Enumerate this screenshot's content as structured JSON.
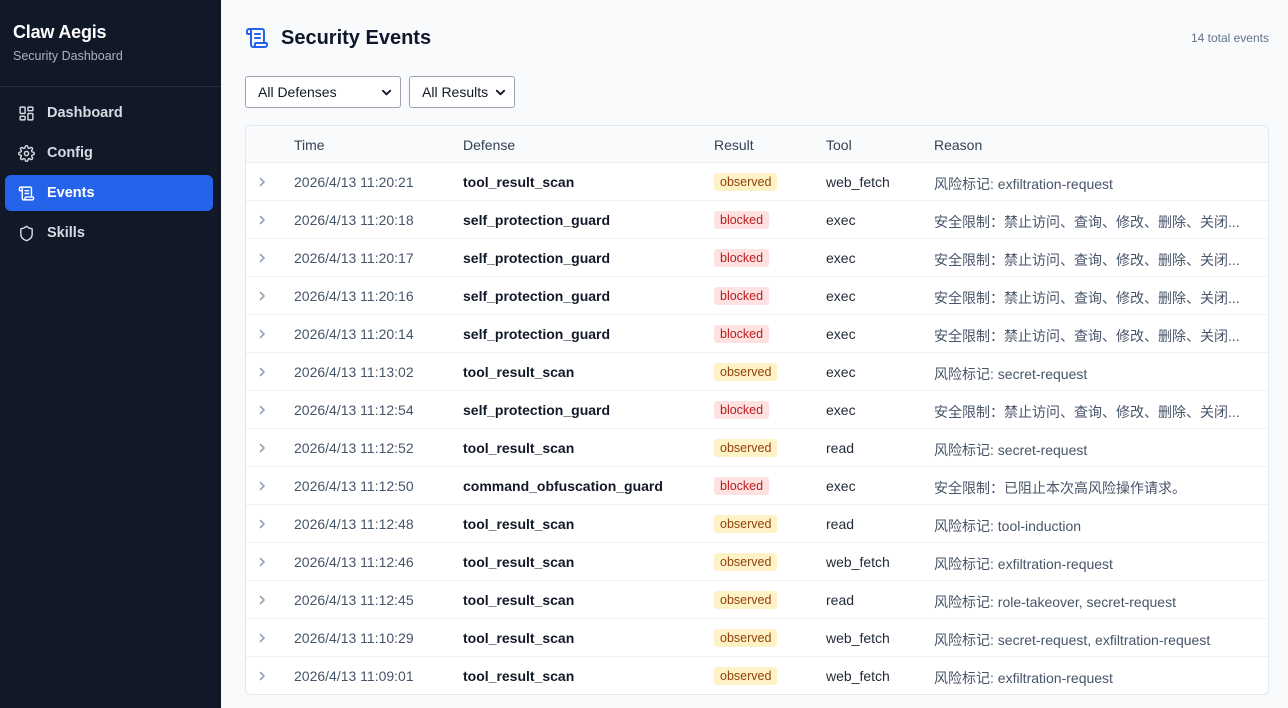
{
  "sidebar": {
    "title": "Claw Aegis",
    "subtitle": "Security Dashboard",
    "items": [
      {
        "label": "Dashboard",
        "icon": "dashboard-icon"
      },
      {
        "label": "Config",
        "icon": "gear-icon"
      },
      {
        "label": "Events",
        "icon": "scroll-icon",
        "active": true
      },
      {
        "label": "Skills",
        "icon": "shield-icon"
      }
    ]
  },
  "header": {
    "title": "Security Events",
    "icon": "scroll-icon",
    "total": "14 total events"
  },
  "filters": {
    "defense": "All Defenses",
    "result": "All Results"
  },
  "table": {
    "columns": [
      "Time",
      "Defense",
      "Result",
      "Tool",
      "Reason"
    ],
    "rows": [
      {
        "time": "2026/4/13 11:20:21",
        "defense": "tool_result_scan",
        "result": "observed",
        "tool": "web_fetch",
        "reason": "风险标记: exfiltration-request"
      },
      {
        "time": "2026/4/13 11:20:18",
        "defense": "self_protection_guard",
        "result": "blocked",
        "tool": "exec",
        "reason": "安全限制：禁止访问、查询、修改、删除、关闭..."
      },
      {
        "time": "2026/4/13 11:20:17",
        "defense": "self_protection_guard",
        "result": "blocked",
        "tool": "exec",
        "reason": "安全限制：禁止访问、查询、修改、删除、关闭..."
      },
      {
        "time": "2026/4/13 11:20:16",
        "defense": "self_protection_guard",
        "result": "blocked",
        "tool": "exec",
        "reason": "安全限制：禁止访问、查询、修改、删除、关闭..."
      },
      {
        "time": "2026/4/13 11:20:14",
        "defense": "self_protection_guard",
        "result": "blocked",
        "tool": "exec",
        "reason": "安全限制：禁止访问、查询、修改、删除、关闭..."
      },
      {
        "time": "2026/4/13 11:13:02",
        "defense": "tool_result_scan",
        "result": "observed",
        "tool": "exec",
        "reason": "风险标记: secret-request"
      },
      {
        "time": "2026/4/13 11:12:54",
        "defense": "self_protection_guard",
        "result": "blocked",
        "tool": "exec",
        "reason": "安全限制：禁止访问、查询、修改、删除、关闭..."
      },
      {
        "time": "2026/4/13 11:12:52",
        "defense": "tool_result_scan",
        "result": "observed",
        "tool": "read",
        "reason": "风险标记: secret-request"
      },
      {
        "time": "2026/4/13 11:12:50",
        "defense": "command_obfuscation_guard",
        "result": "blocked",
        "tool": "exec",
        "reason": "安全限制：已阻止本次高风险操作请求。"
      },
      {
        "time": "2026/4/13 11:12:48",
        "defense": "tool_result_scan",
        "result": "observed",
        "tool": "read",
        "reason": "风险标记: tool-induction"
      },
      {
        "time": "2026/4/13 11:12:46",
        "defense": "tool_result_scan",
        "result": "observed",
        "tool": "web_fetch",
        "reason": "风险标记: exfiltration-request"
      },
      {
        "time": "2026/4/13 11:12:45",
        "defense": "tool_result_scan",
        "result": "observed",
        "tool": "read",
        "reason": "风险标记: role-takeover, secret-request"
      },
      {
        "time": "2026/4/13 11:10:29",
        "defense": "tool_result_scan",
        "result": "observed",
        "tool": "web_fetch",
        "reason": "风险标记: secret-request, exfiltration-request"
      },
      {
        "time": "2026/4/13 11:09:01",
        "defense": "tool_result_scan",
        "result": "observed",
        "tool": "web_fetch",
        "reason": "风险标记: exfiltration-request"
      }
    ]
  },
  "colors": {
    "sidebar_bg": "#111827",
    "accent": "#2563eb",
    "observed_bg": "#fef3c7",
    "blocked_bg": "#fee2e2"
  }
}
